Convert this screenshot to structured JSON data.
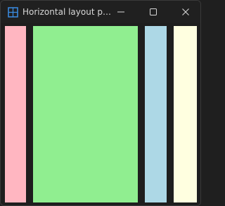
{
  "window": {
    "title": "Horizontal layout pa...",
    "icons": {
      "app": "layout-window-icon",
      "minimize": "minimize-icon",
      "maximize": "maximize-icon",
      "close": "close-icon"
    }
  },
  "panels": [
    {
      "name": "pink-panel",
      "color": "#FFB6C1"
    },
    {
      "name": "green-panel",
      "color": "#90EE90"
    },
    {
      "name": "blue-panel",
      "color": "#ADD8E6"
    },
    {
      "name": "cream-panel",
      "color": "#FFFFE0"
    }
  ]
}
